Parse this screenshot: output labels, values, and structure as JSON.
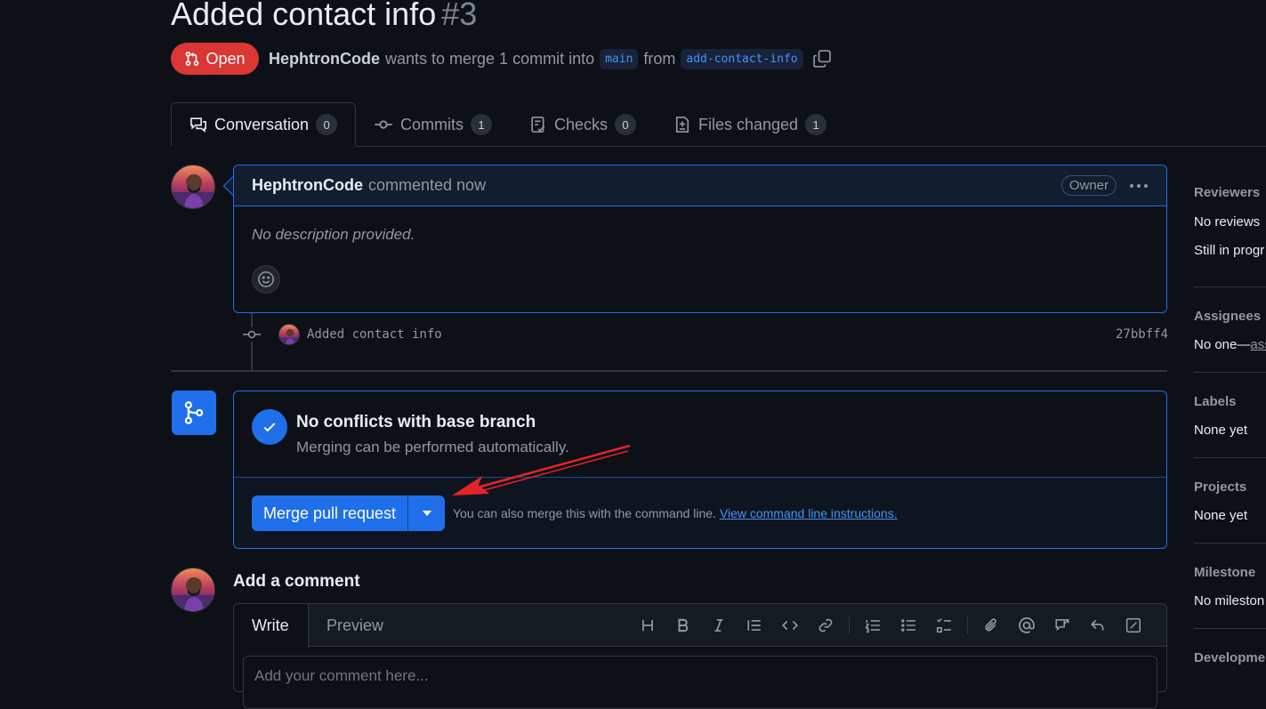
{
  "pr": {
    "title": "Added contact info",
    "number": "#3",
    "state": "Open",
    "author": "HephtronCode",
    "merge_text": "wants to merge 1 commit into",
    "base_branch": "main",
    "from_text": "from",
    "head_branch": "add-contact-info"
  },
  "tabs": [
    {
      "label": "Conversation",
      "count": "0"
    },
    {
      "label": "Commits",
      "count": "1"
    },
    {
      "label": "Checks",
      "count": "0"
    },
    {
      "label": "Files changed",
      "count": "1"
    }
  ],
  "comment": {
    "author": "HephtronCode",
    "action": "commented now",
    "role": "Owner",
    "body": "No description provided."
  },
  "commit": {
    "message": "Added contact info",
    "sha": "27bbff4"
  },
  "merge": {
    "title": "No conflicts with base branch",
    "subtitle": "Merging can be performed automatically.",
    "button": "Merge pull request",
    "cli_text": "You can also merge this with the command line.",
    "cli_link": "View command line instructions."
  },
  "add_comment": {
    "title": "Add a comment",
    "tab_write": "Write",
    "tab_preview": "Preview",
    "placeholder": "Add your comment here..."
  },
  "sidebar": {
    "reviewers_label": "Reviewers",
    "reviewers_value": "No reviews",
    "reviewers_status": "Still in progr",
    "assignees_label": "Assignees",
    "assignees_value": "No one—",
    "assignees_link": "ass",
    "labels_label": "Labels",
    "labels_value": "None yet",
    "projects_label": "Projects",
    "projects_value": "None yet",
    "milestone_label": "Milestone",
    "milestone_value": "No mileston",
    "development_label": "Developmen"
  },
  "colors": {
    "background": "#0d1117",
    "accent": "#1f6feb",
    "open_badge": "#da3633",
    "link": "#4493f8",
    "annotation_arrow": "#e5232a"
  }
}
